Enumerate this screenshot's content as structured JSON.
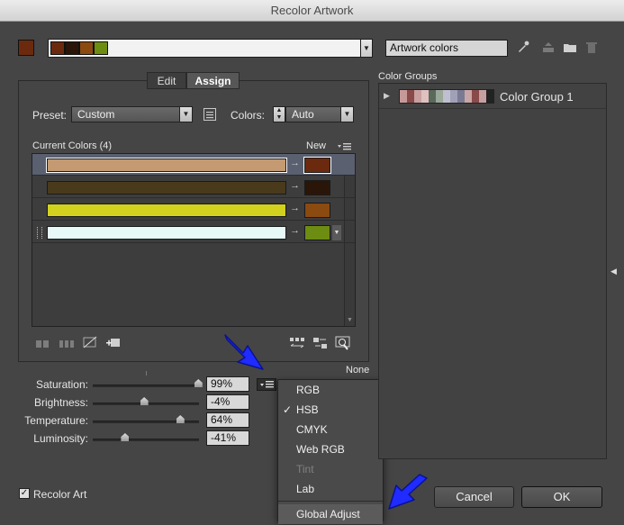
{
  "window": {
    "title": "Recolor Artwork"
  },
  "top": {
    "active_color": "#6b2a0e",
    "strip_colors": [
      "#6b2a0e",
      "#2a1608",
      "#8a4a10",
      "#6c8c12"
    ],
    "name_value": "Artwork colors"
  },
  "tabs": [
    {
      "label": "Edit"
    },
    {
      "label": "Assign"
    }
  ],
  "preset": {
    "label": "Preset:",
    "value": "Custom"
  },
  "colors_count": {
    "label": "Colors:",
    "value": "Auto"
  },
  "current_colors": {
    "header": "Current Colors (4)",
    "new_header": "New",
    "rows": [
      {
        "current": "#c39a72",
        "new": "#6b2a0e"
      },
      {
        "current": "#4a3a1c",
        "new": "#2a1608"
      },
      {
        "current": "#d2d21e",
        "new": "#8a4a10"
      },
      {
        "current": "#e6f8f8",
        "new": "#6c8c12"
      }
    ]
  },
  "color_groups": {
    "label": "Color Groups",
    "items": [
      {
        "name": "Color Group 1",
        "colors": [
          "#c79a9a",
          "#8a4a4a",
          "#c9a0a0",
          "#e0c0c0",
          "#5a6a5a",
          "#9aa89a",
          "#bfbfd0",
          "#a0a0b8",
          "#7a7a95",
          "#caa6a6",
          "#8a4a4a",
          "#c6a0a0",
          "#222222"
        ]
      }
    ]
  },
  "sliders": [
    {
      "label": "Saturation:",
      "value": "99%",
      "level": 0.99
    },
    {
      "label": "Brightness:",
      "value": "-4%",
      "level": 0.48
    },
    {
      "label": "Temperature:",
      "value": "64%",
      "level": 0.82
    },
    {
      "label": "Luminosity:",
      "value": "-41%",
      "level": 0.3
    }
  ],
  "none_label": "None",
  "mode_menu": {
    "items": [
      {
        "label": "RGB",
        "checked": false,
        "disabled": false
      },
      {
        "label": "HSB",
        "checked": true,
        "disabled": false
      },
      {
        "label": "CMYK",
        "checked": false,
        "disabled": false
      },
      {
        "label": "Web RGB",
        "checked": false,
        "disabled": false
      },
      {
        "label": "Tint",
        "checked": false,
        "disabled": true
      },
      {
        "label": "Lab",
        "checked": false,
        "disabled": false
      },
      {
        "label": "Global Adjust",
        "checked": false,
        "disabled": false
      }
    ]
  },
  "recolor_art": {
    "label": "Recolor Art",
    "checked": true
  },
  "buttons": {
    "cancel": "Cancel",
    "ok": "OK"
  },
  "annotation_color": "#1f2bff"
}
